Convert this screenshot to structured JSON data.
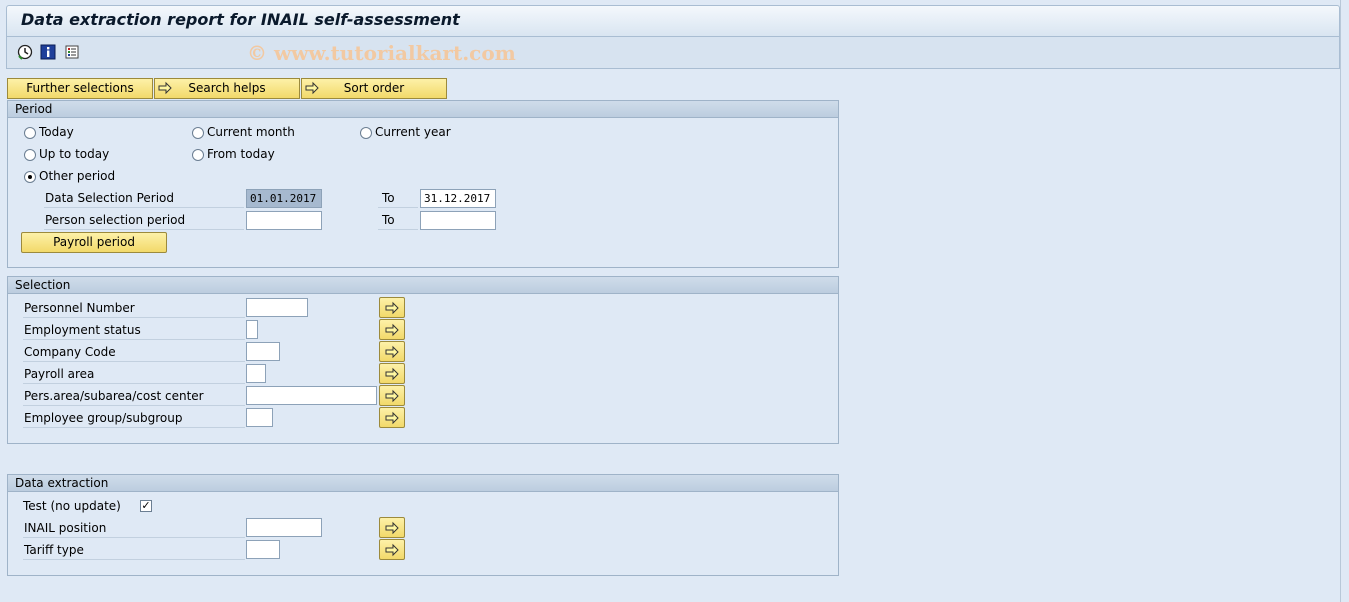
{
  "window": {
    "title": "Data extraction report for INAIL self-assessment",
    "watermark": "© www.tutorialkart.com"
  },
  "toolbar": {
    "icons": [
      "execute-icon",
      "info-icon",
      "variant-icon"
    ]
  },
  "selection_buttons": {
    "further": "Further selections",
    "search_helps": "Search helps",
    "sort_order": "Sort order"
  },
  "period": {
    "header": "Period",
    "today": "Today",
    "current_month": "Current month",
    "current_year": "Current year",
    "up_to_today": "Up to today",
    "from_today": "From today",
    "other_period": "Other period",
    "selected": "other_period",
    "data_sel_label": "Data Selection Period",
    "data_sel_from": "01.01.2017",
    "data_sel_to": "31.12.2017",
    "person_sel_label": "Person selection period",
    "person_sel_from": "",
    "person_sel_to": "",
    "to_label": "To",
    "payroll_button": "Payroll period"
  },
  "selection": {
    "header": "Selection",
    "rows": [
      {
        "label": "Personnel Number",
        "value": ""
      },
      {
        "label": "Employment status",
        "value": ""
      },
      {
        "label": "Company Code",
        "value": ""
      },
      {
        "label": "Payroll area",
        "value": ""
      },
      {
        "label": "Pers.area/subarea/cost center",
        "value": ""
      },
      {
        "label": "Employee group/subgroup",
        "value": ""
      }
    ]
  },
  "extraction": {
    "header": "Data extraction",
    "test_label": "Test (no update)",
    "test_checked": true,
    "check_mark": "✓",
    "inail_label": "INAIL position",
    "inail_value": "",
    "tariff_label": "Tariff type",
    "tariff_value": ""
  }
}
